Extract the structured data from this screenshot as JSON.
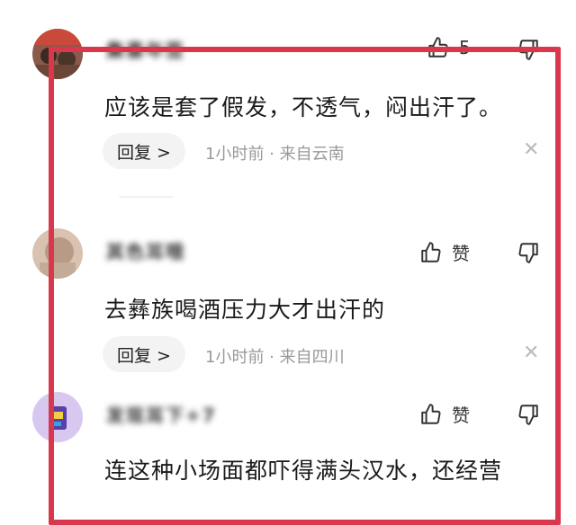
{
  "comments": [
    {
      "username": "集喜年签",
      "like_label": "5",
      "text": "应该是套了假发，不透气，闷出汗了。",
      "reply_label": "回复 >",
      "meta": "1小时前 · 来自云南"
    },
    {
      "username": "其色耳哦",
      "like_label": "赞",
      "text": "去彝族喝酒压力大才出汗的",
      "reply_label": "回复 >",
      "meta": "1小时前 · 来自四川"
    },
    {
      "username": "发现耳下+7",
      "like_label": "赞",
      "text": "连这种小场面都吓得满头汉水，还经营"
    }
  ],
  "colors": {
    "highlight_frame": "#d9374b",
    "meta_text": "#999999",
    "reply_bg": "#f3f3f3"
  },
  "icons": [
    "thumbs-up-icon",
    "thumbs-down-icon",
    "close-icon"
  ]
}
